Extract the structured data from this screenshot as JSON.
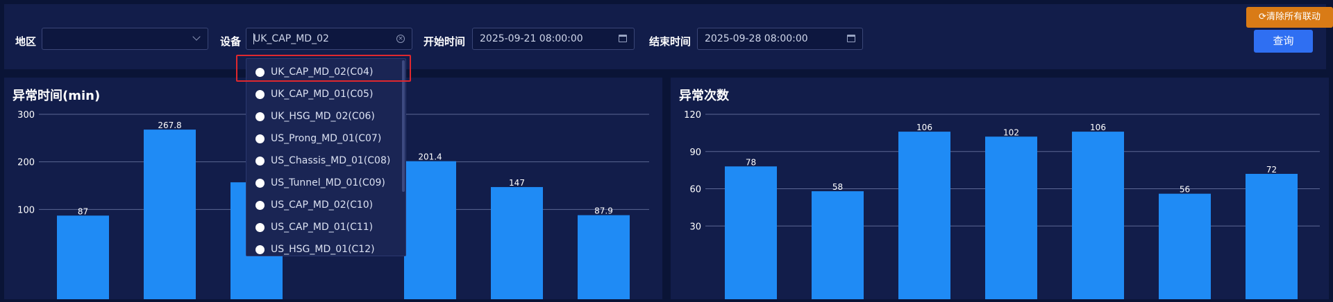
{
  "filters": {
    "region": {
      "label": "地区",
      "value": ""
    },
    "device": {
      "label": "设备",
      "value": "UK_CAP_MD_02"
    },
    "start": {
      "label": "开始时间",
      "value": "2025-09-21 08:00:00"
    },
    "end": {
      "label": "结束时间",
      "value": "2025-09-28 08:00:00"
    }
  },
  "buttons": {
    "clear_links": "清除所有联动",
    "query": "查询"
  },
  "device_options": [
    "UK_CAP_MD_02(C04)",
    "UK_CAP_MD_01(C05)",
    "UK_HSG_MD_02(C06)",
    "US_Prong_MD_01(C07)",
    "US_Chassis_MD_01(C08)",
    "US_Tunnel_MD_01(C09)",
    "US_CAP_MD_02(C10)",
    "US_CAP_MD_01(C11)",
    "US_HSG_MD_01(C12)"
  ],
  "colors": {
    "bar": "#1f8bf5",
    "highlight": "#e0282e",
    "orange": "#d97b16",
    "blue_btn": "#2f6ff2"
  },
  "chart_data": [
    {
      "type": "bar",
      "title": "异常时间(min)",
      "yticks": [
        100,
        200,
        300
      ],
      "ylim": [
        0,
        300
      ],
      "values": [
        87,
        267.8,
        157,
        null,
        201.4,
        147,
        87.9
      ],
      "labels": [
        "87",
        "267.8",
        "",
        "",
        "201.4",
        "147",
        "87.9"
      ]
    },
    {
      "type": "bar",
      "title": "异常次数",
      "yticks": [
        30,
        60,
        90,
        120
      ],
      "ylim": [
        0,
        120
      ],
      "values": [
        78,
        58,
        106,
        102,
        106,
        56,
        72
      ],
      "labels": [
        "78",
        "58",
        "106",
        "102",
        "106",
        "56",
        "72"
      ]
    }
  ]
}
